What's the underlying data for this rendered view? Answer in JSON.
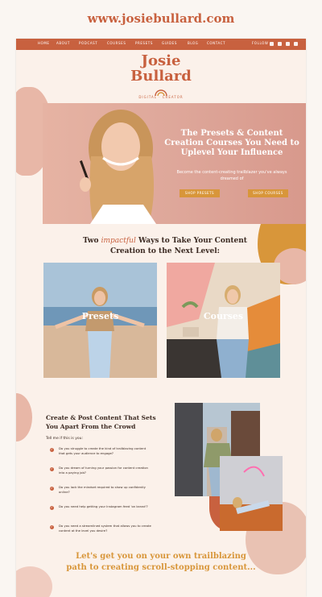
{
  "site_url": "www.josiebullard.com",
  "nav": {
    "items": [
      "HOME",
      "ABOUT",
      "PODCAST",
      "COURSES",
      "PRESETS",
      "GUIDES",
      "BLOG",
      "CONTACT"
    ],
    "follow_label": "FOLLOW",
    "social_icons": [
      "facebook-icon",
      "instagram-icon",
      "youtube-icon",
      "pinterest-icon"
    ]
  },
  "logo": {
    "line1": "Josie",
    "line2": "Bullard",
    "tagline": "DIGITAL · CREATOR"
  },
  "hero": {
    "headline": "The Presets & Content Creation Courses You Need to Uplevel Your Influence",
    "subtext": "Become the content-creating trailblazer you've always dreamed of",
    "shop_presets_label": "SHOP PRESETS",
    "shop_courses_label": "SHOP COURSES"
  },
  "ways": {
    "prefix": "Two",
    "script_word": "impactful",
    "suffix": "Ways to Take Your Content Creation to the Next Level:"
  },
  "cards": {
    "presets_label": "Presets",
    "courses_label": "Courses"
  },
  "content_section": {
    "heading": "Create & Post Content That Sets You Apart From the Crowd",
    "intro": "Tell me if this is you:",
    "items": [
      "Do you struggle to create the kind of trailblazing content that gets your audience to engage?",
      "Do you dream of turning your passion for content creation into a paying job?",
      "Do you lack the mindset required to show up confidently online?",
      "Do you need help getting your Instagram feed 'on brand'?",
      "Do you need a streamlined system that allows you to create content at the level you desire?"
    ]
  },
  "bottom": {
    "headline": "Let's get you on your own trailblazing path to creating scroll-stopping content..."
  },
  "colors": {
    "accent": "#c8613f",
    "gold": "#d8963a",
    "background": "#fbf1ea"
  }
}
